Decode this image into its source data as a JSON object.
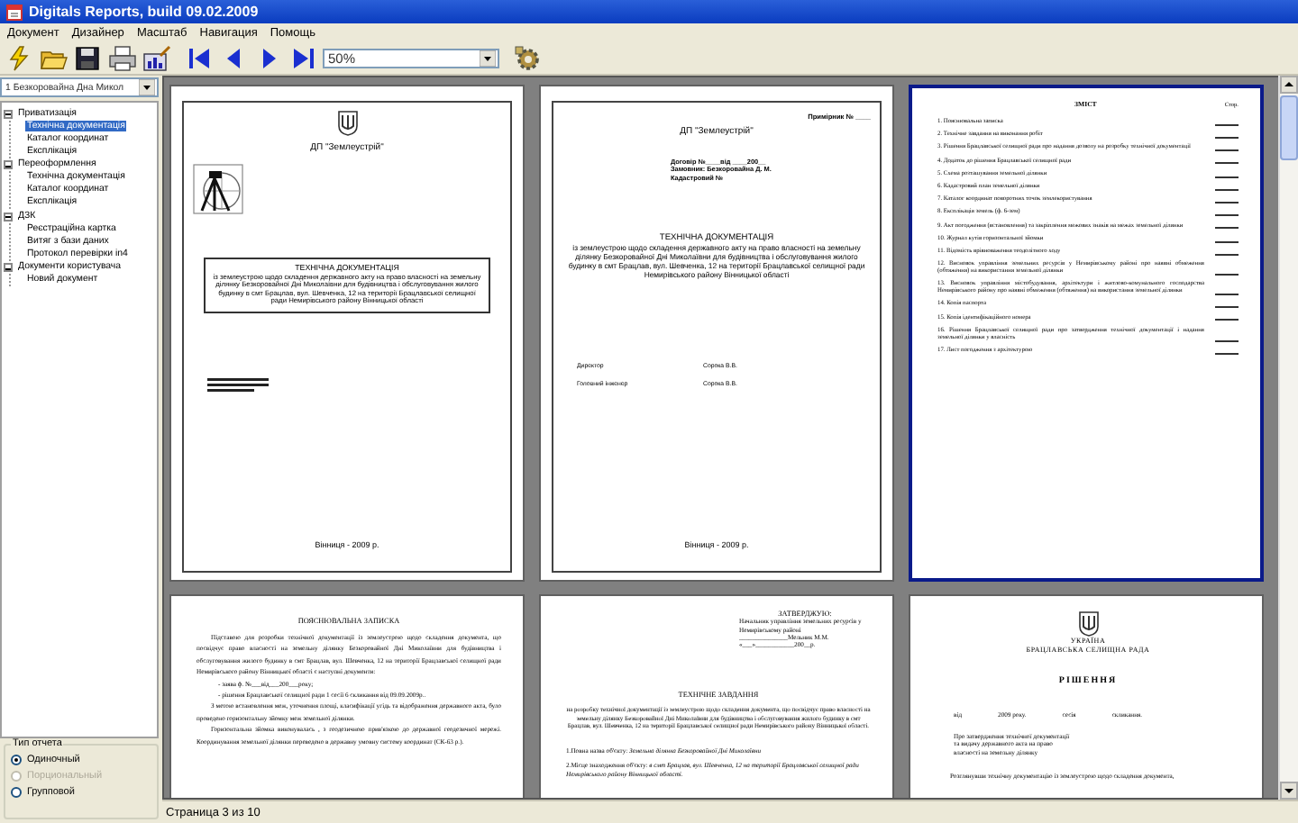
{
  "window": {
    "title": "Digitals Reports, build 09.02.2009"
  },
  "menu": [
    "Документ",
    "Дизайнер",
    "Масштаб",
    "Навигация",
    "Помощь"
  ],
  "toolbar": {
    "zoom": {
      "value": "50%"
    }
  },
  "sidebar": {
    "record_select": {
      "value": "1 Безкоровайна Дна Микол"
    },
    "tree": [
      {
        "label": "Приватизація",
        "expanded": true,
        "selected": false,
        "children": [
          {
            "label": "Технічна документація",
            "selected": true
          },
          {
            "label": "Каталог координат",
            "selected": false
          },
          {
            "label": "Експлікація",
            "selected": false
          }
        ]
      },
      {
        "label": "Переоформлення",
        "expanded": true,
        "selected": false,
        "children": [
          {
            "label": "Технічна документація",
            "selected": false
          },
          {
            "label": "Каталог координат",
            "selected": false
          },
          {
            "label": "Експлікація",
            "selected": false
          }
        ]
      },
      {
        "label": "ДЗК",
        "expanded": true,
        "selected": false,
        "children": [
          {
            "label": "Реєстраційна картка",
            "selected": false
          },
          {
            "label": "Витяг з бази даних",
            "selected": false
          },
          {
            "label": "Протокол перевірки in4",
            "selected": false
          }
        ]
      },
      {
        "label": "Документи користувача",
        "expanded": true,
        "selected": false,
        "children": [
          {
            "label": "Новий документ",
            "selected": false
          }
        ]
      }
    ],
    "report_type": {
      "title": "Тип отчета",
      "options": [
        {
          "label": "Одиночный",
          "selected": true,
          "disabled": false
        },
        {
          "label": "Порциональный",
          "selected": false,
          "disabled": true
        },
        {
          "label": "Групповой",
          "selected": false,
          "disabled": false
        }
      ]
    }
  },
  "pages": [
    {
      "kind": "title_sheet",
      "selected": false,
      "blocks": [
        {
          "kind": "emblem"
        },
        {
          "kind": "org",
          "text": "ДП \"Землеустрій\""
        },
        {
          "kind": "logo"
        },
        {
          "kind": "framed",
          "heading": "ТЕХНІЧНА ДОКУМЕНТАЦІЯ",
          "text": "із землеустрою щодо складення державного акту на право власності на земельну ділянку Безкоровайної Дні Миколаївни для будівництва і обслуговування жилого будинку в смт Брацлав, вул. Шевченка, 12 на території Брацлавської селищної ради Немирівського району Вінницької області"
        },
        {
          "kind": "stamp"
        },
        {
          "kind": "footer",
          "text": "Вінниця - 2009 р."
        }
      ]
    },
    {
      "kind": "title_sheet",
      "selected": false,
      "blocks": [
        {
          "kind": "corner",
          "text": "Примірник № ____"
        },
        {
          "kind": "org",
          "text": "ДП \"Землеустрій\""
        },
        {
          "kind": "details",
          "lines": [
            "Договір №____від ____200__",
            "Замовник: Безкоровайна Д. М.",
            "Кадастровий №"
          ]
        },
        {
          "kind": "title",
          "heading": "ТЕХНІЧНА ДОКУМЕНТАЦІЯ",
          "text": "із землеустрою щодо складення державного акту на право власності на земельну ділянку Безкоровайної Дні Миколаївни для будівництва і обслуговування жилого будинку в смт Брацлав, вул. Шевченка, 12 на території Брацлавської селищної ради Немирівського району Вінницької області"
        },
        {
          "kind": "signatures",
          "rows": [
            {
              "role": "Директор",
              "name": "Сорока В.В."
            },
            {
              "role": "Головний інженер",
              "name": "Сорока В.В."
            }
          ]
        },
        {
          "kind": "footer",
          "text": "Вінниця - 2009 р."
        }
      ]
    },
    {
      "kind": "text_sheet",
      "selected": true,
      "blocks": [
        {
          "kind": "toc",
          "header": "ЗМІСТ",
          "column": "Стор.",
          "items": [
            "1. Пояснювальна записка",
            "2. Технічне завдання на виконання робіт",
            "3. Рішення Брацлавської селищної ради про надання дозволу на розробку технічної документації",
            "4. Додаток до рішення Брацлавської селищної ради",
            "5. Схема розташування земельної ділянки",
            "6. Кадастровий план земельної ділянки",
            "7. Каталог координат поворотних точок землекористування",
            "8. Експлікація земель (ф. 6-зем)",
            "9. Акт погодження (встановлення) та закріплення межових знаків на межах земельної ділянки",
            "10. Журнал кутів горизонтальної зйомки",
            "11. Відомість врівноваження теодолітного ходу",
            "12. Висновок управління земельних ресурсів у Немирівському районі про наявні обмеження (обтяження) на використання земельної ділянки",
            "13. Висновок управління містобудування, архітектури і житлово-комунального господарства Немирівського району про наявні обмеження (обтяження) на використання земельної ділянки",
            "14. Копія паспорта",
            "15. Копія ідентифікаційного номера",
            "16. Рішення Брацлавської селищної ради про затвердження технічної документації і надання земельної ділянки у власність",
            "17. Лист погодження з архітектурою"
          ]
        }
      ]
    },
    {
      "kind": "text_sheet",
      "selected": false,
      "blocks": [
        {
          "kind": "heading",
          "text": "ПОЯСНЮВАЛЬНА ЗАПИСКА"
        },
        {
          "kind": "para",
          "text": "Підставою для розробки технічної документації із землеустрою щодо складення документа, що посвідчує право власності на земельну ділянку Безкоровайної Дні Миколаївни для будівництва і обслуговування жилого будинку в смт Брацлав, вул. Шевченка, 12 на території Брацлавської селищної ради Немирівського району Вінницької області є наступні документи:"
        },
        {
          "kind": "item",
          "text": "- заява ф. №___від___200___року;"
        },
        {
          "kind": "item",
          "text": "- рішення Брацлавської селищної ради 1 сесії 6 скликання від 09.09.2009р.."
        },
        {
          "kind": "para",
          "text": "З метою встановлення меж, уточнення площі, класифікації угідь та відображення державного акта, було проведено горизонтальну зйомку меж земельної ділянки."
        },
        {
          "kind": "para",
          "text": "Горизонтальна зйомка виконувалась , з геодезичною прив'язкою до державної геодезичної мережі. Координування земельної ділянки переведено в державну умовну систему координат (СК-63 р.)."
        }
      ]
    },
    {
      "kind": "text_sheet",
      "selected": false,
      "blocks": [
        {
          "kind": "approve",
          "lines": [
            "ЗАТВЕРДЖУЮ:",
            "Начальник управління земельних ресурсів у Немирівському районі",
            "_______________Мельник М.М.",
            "«___»____________200__р."
          ]
        },
        {
          "kind": "heading",
          "text": "ТЕХНІЧНЕ ЗАВДАННЯ"
        },
        {
          "kind": "subtitle",
          "text": "на розробку технічної документації із землеустрою щодо складення документа, що посвідчує право власності на земельну ділянку Безкоровайної Дні Миколаївни для будівництва і обслуговування жилого будинку в смт Брацлав, вул. Шевченка, 12 на території Брацлавської селищної ради Немирівського району Вінницької області."
        },
        {
          "kind": "field",
          "text": "1.Повна назва об'єкту: *Земельна ділянка Безкоровайної Дні Миколаївни*"
        },
        {
          "kind": "field",
          "text": "2.Місце знаходження об'єкту: *в смт Брацлав, вул. Шевченка, 12 на території Брацлавської селищної ради Немирівського району Вінницької області.*"
        }
      ]
    },
    {
      "kind": "text_sheet",
      "selected": false,
      "blocks": [
        {
          "kind": "emblem"
        },
        {
          "kind": "caption",
          "text": "УКРАЇНА"
        },
        {
          "kind": "caption",
          "text": "БРАЦЛАВСЬКА СЕЛИЩНА РАДА"
        },
        {
          "kind": "decision",
          "text": "РІШЕННЯ"
        },
        {
          "kind": "dateline",
          "parts": [
            "від",
            "2009 року.",
            "сесія",
            "скликання."
          ]
        },
        {
          "kind": "subject",
          "lines": [
            "Про затвердження технічної документації",
            "та видачу державного акта на право",
            "власності на земельну ділянку"
          ]
        },
        {
          "kind": "para",
          "text": "Розглянувши технічну документацію із землеустрою щодо складення документа,"
        }
      ]
    }
  ],
  "status_bar": "Страница 3 из 10"
}
